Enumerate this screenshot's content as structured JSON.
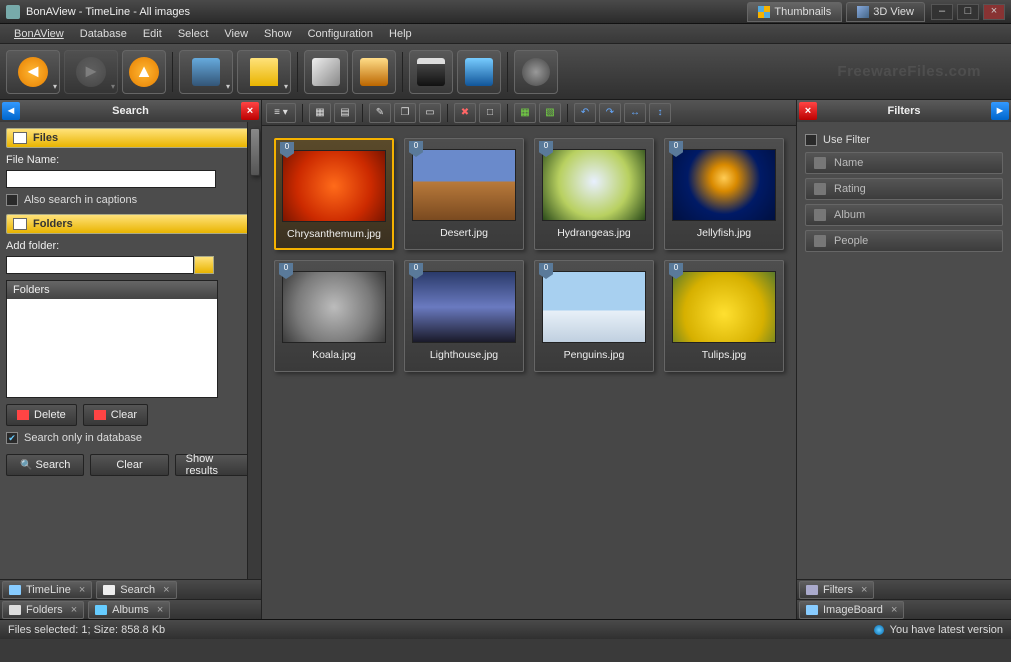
{
  "title": "BonAView - TimeLine - All images",
  "watermark": "FreewareFiles.com",
  "viewtabs": [
    {
      "label": "Thumbnails",
      "active": true
    },
    {
      "label": "3D View",
      "active": false
    }
  ],
  "menu": [
    "BonAView",
    "Database",
    "Edit",
    "Select",
    "View",
    "Show",
    "Configuration",
    "Help"
  ],
  "search_panel": {
    "title": "Search",
    "files_section": "Files",
    "filename_label": "File Name:",
    "filename_value": "",
    "also_captions": "Also search in captions",
    "also_captions_checked": false,
    "folders_section": "Folders",
    "addfolder_label": "Add folder:",
    "addfolder_value": "",
    "folders_header": "Folders",
    "delete_btn": "Delete",
    "clear_btn": "Clear",
    "search_only_db": "Search only in database",
    "search_only_db_checked": true,
    "search_btn": "Search",
    "clear2_btn": "Clear",
    "showresults_btn": "Show results"
  },
  "left_tabs_row1": [
    {
      "label": "TimeLine"
    },
    {
      "label": "Search"
    }
  ],
  "left_tabs_row2": [
    {
      "label": "Folders"
    },
    {
      "label": "Albums"
    }
  ],
  "thumbnails": [
    {
      "caption": "Chrysanthemum.jpg",
      "cls": "fake-chrys",
      "selected": true,
      "badge": "0"
    },
    {
      "caption": "Desert.jpg",
      "cls": "fake-desert",
      "selected": false,
      "badge": "0"
    },
    {
      "caption": "Hydrangeas.jpg",
      "cls": "fake-hydra",
      "selected": false,
      "badge": "0"
    },
    {
      "caption": "Jellyfish.jpg",
      "cls": "fake-jelly",
      "selected": false,
      "badge": "0"
    },
    {
      "caption": "Koala.jpg",
      "cls": "fake-koala",
      "selected": false,
      "badge": "0"
    },
    {
      "caption": "Lighthouse.jpg",
      "cls": "fake-light",
      "selected": false,
      "badge": "0"
    },
    {
      "caption": "Penguins.jpg",
      "cls": "fake-peng",
      "selected": false,
      "badge": "0"
    },
    {
      "caption": "Tulips.jpg",
      "cls": "fake-tulip",
      "selected": false,
      "badge": "0"
    }
  ],
  "filters_panel": {
    "title": "Filters",
    "use_filter": "Use Filter",
    "use_filter_checked": false,
    "items": [
      "Name",
      "Rating",
      "Album",
      "People"
    ]
  },
  "right_tabs_row1": [
    {
      "label": "Filters"
    }
  ],
  "right_tabs_row2": [
    {
      "label": "ImageBoard"
    }
  ],
  "status_left": "Files selected: 1; Size: 858.8 Kb",
  "status_right": "You have latest version"
}
